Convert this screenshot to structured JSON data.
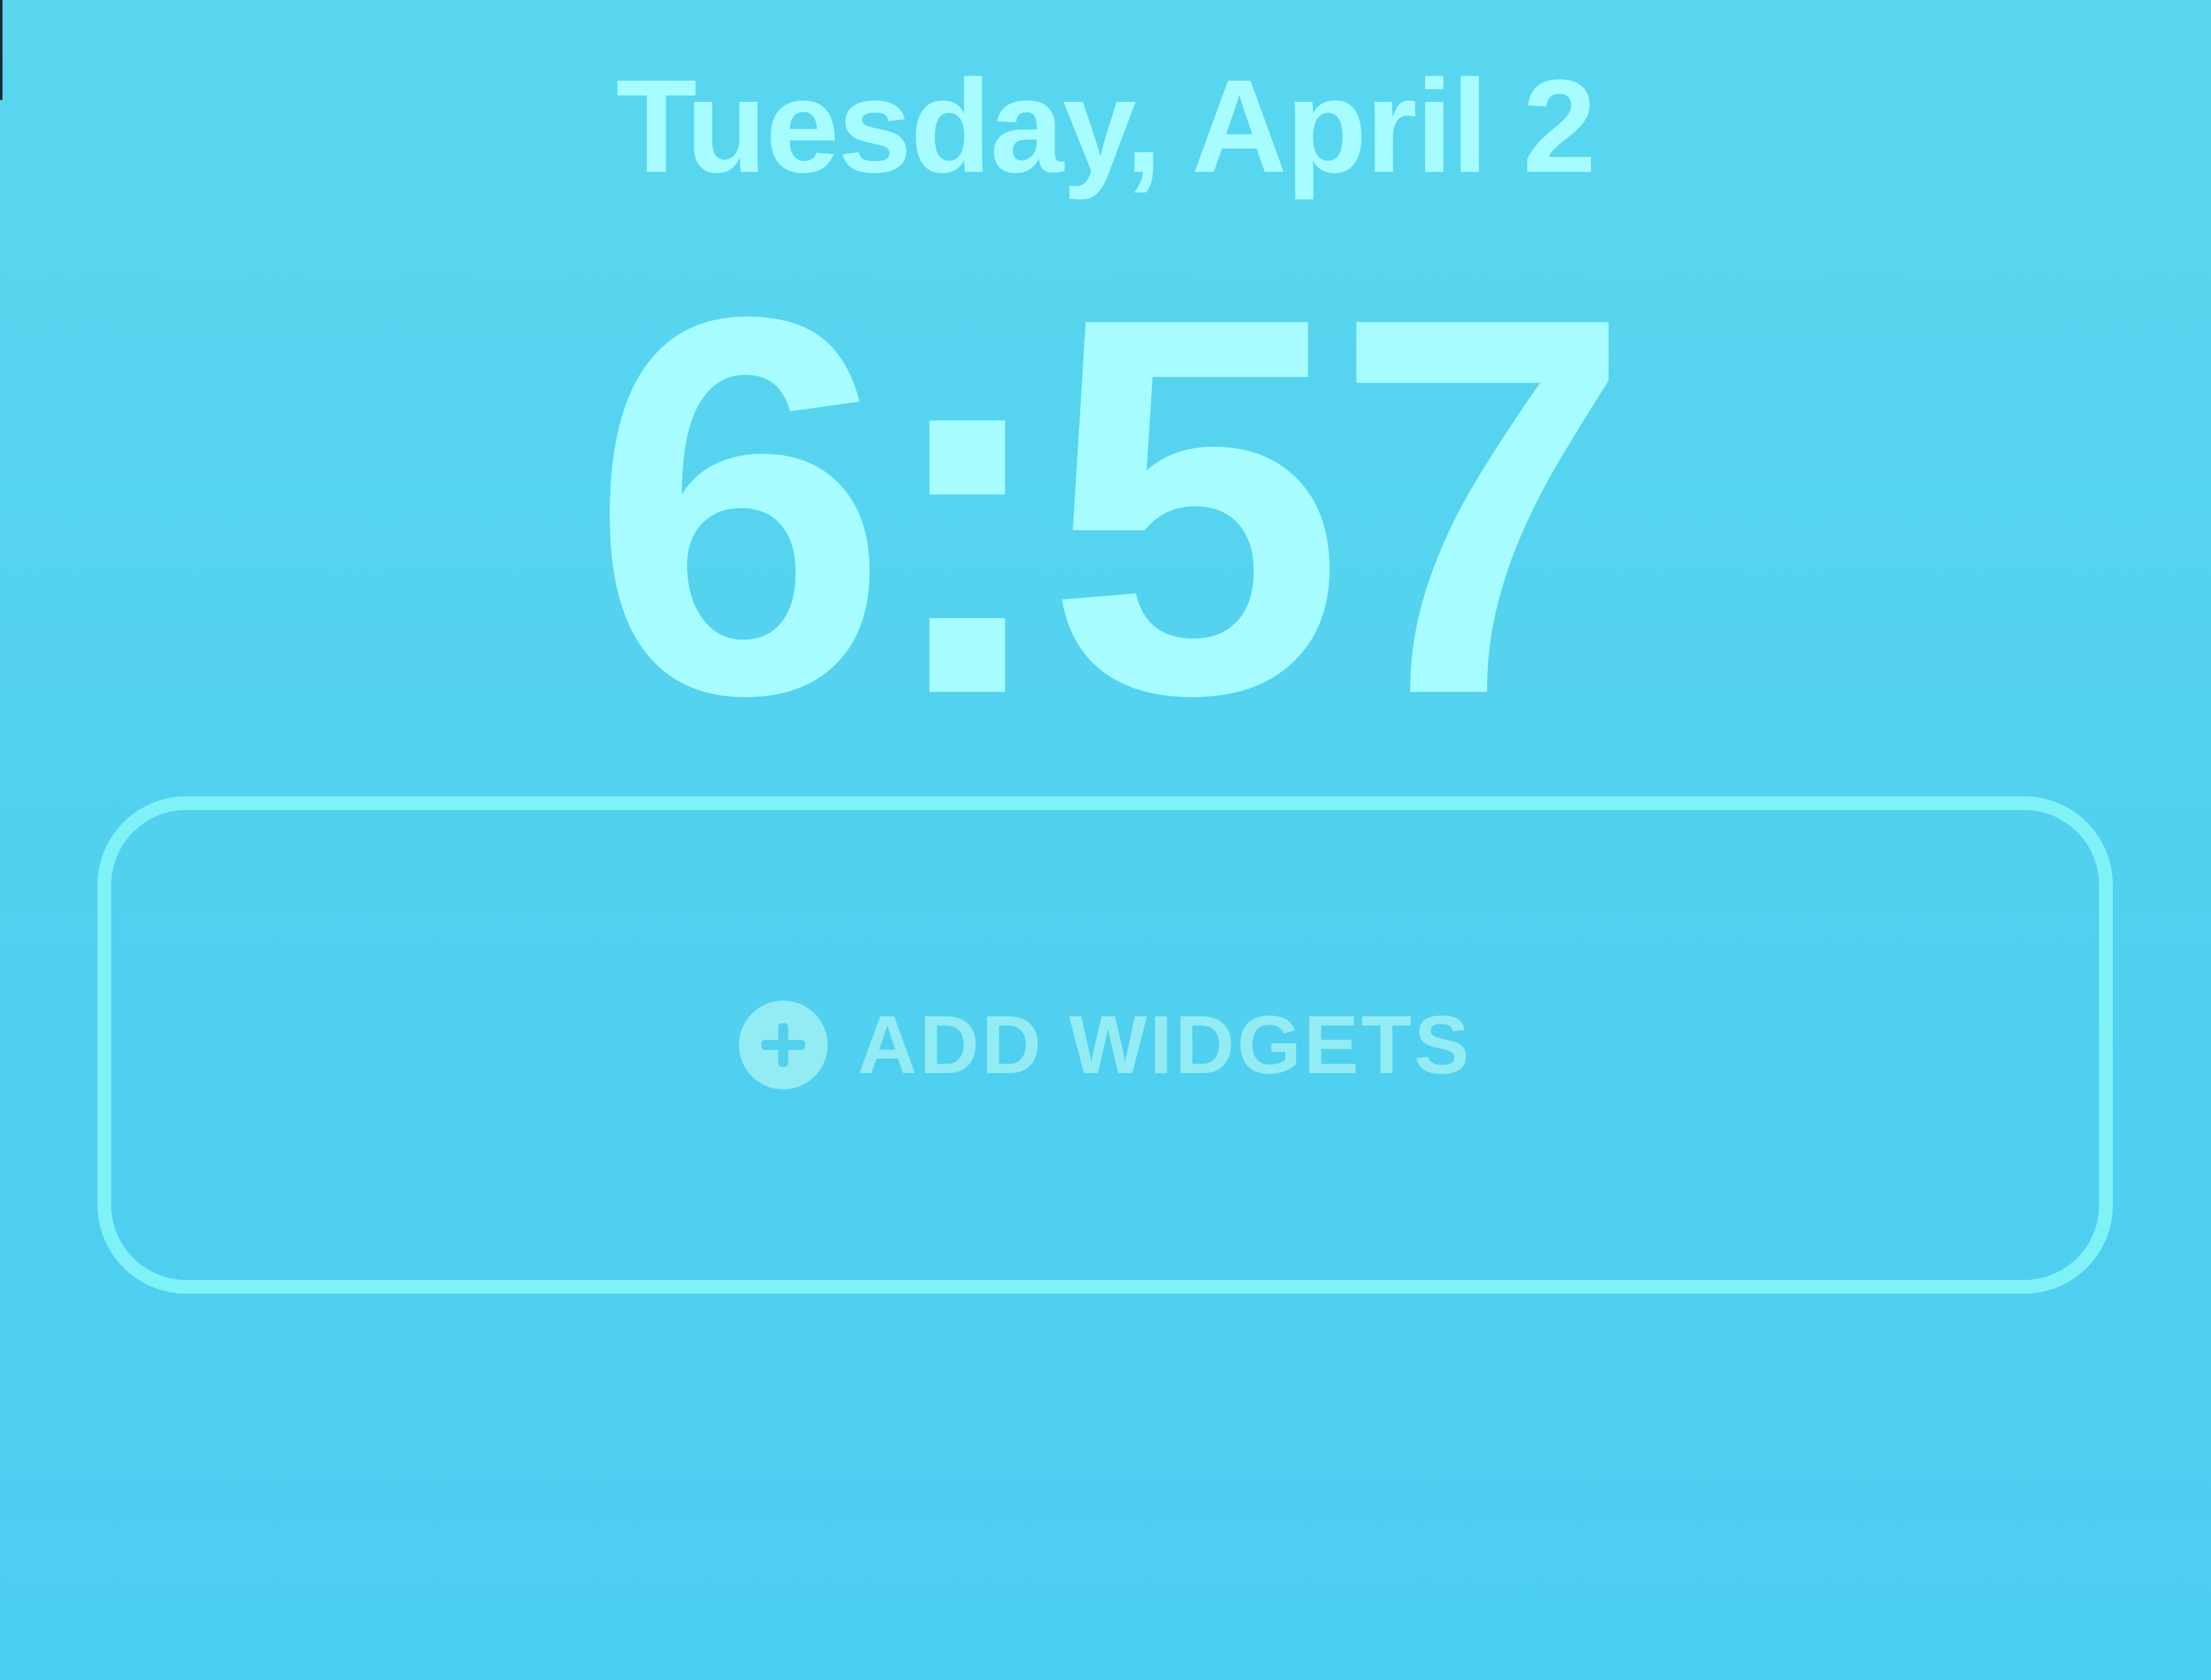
{
  "lock_screen": {
    "date": "Tuesday, April 2",
    "time": "6:57"
  },
  "widget_area": {
    "label": "ADD WIDGETS",
    "icon": "plus-circle-icon"
  },
  "colors": {
    "background_top": "#5ad7ef",
    "background_bottom": "#4ccdf2",
    "text": "#a7fcff",
    "widget_border": "#7ef2f6",
    "widget_label": "#93ecf3"
  }
}
